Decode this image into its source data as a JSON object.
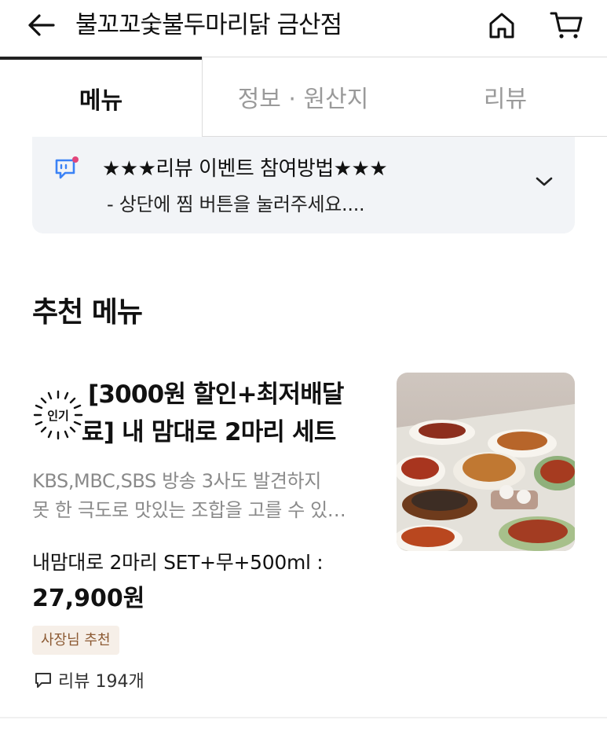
{
  "header": {
    "store_name": "불꼬꼬숯불두마리닭 금산점"
  },
  "tabs": [
    {
      "label": "메뉴",
      "active": true
    },
    {
      "label": "정보 · 원산지",
      "active": false
    },
    {
      "label": "리뷰",
      "active": false
    }
  ],
  "notice": {
    "title": "★★★리뷰 이벤트 참여방법★★★",
    "subtitle": "- 상단에 찜 버튼을 눌러주세요....",
    "icon": "chat-bubble-icon"
  },
  "recommended": {
    "section_title": "추천 메뉴",
    "items": [
      {
        "badge": "인기",
        "name_line1": "[3000원 할인+최저배달",
        "name_line2": "료] 내 맘대로 2마리 세트",
        "desc_line1": "KBS,MBC,SBS 방송 3사도 발견하지",
        "desc_line2": "못 한 극도로 맛있는 조합을 고를 수 있…",
        "option": "내맘대로 2마리 SET+무+500ml :",
        "price": "27,900원",
        "owner_badge": "사장님 추천",
        "review_count": "리뷰 194개"
      }
    ]
  },
  "colors": {
    "text": "#111111",
    "muted": "#9a9a9a",
    "notice_bg": "#f2f4f7",
    "badge_bg": "#f6efe8",
    "badge_text": "#8c5a33",
    "notice_icon": "#3b82f6",
    "notice_dot": "#e2457a"
  }
}
